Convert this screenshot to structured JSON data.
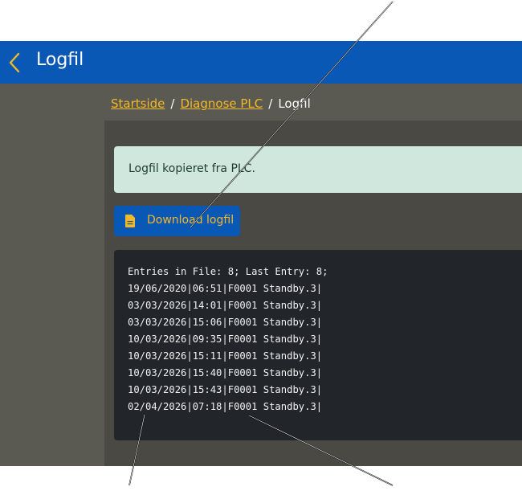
{
  "header": {
    "title": "Logfil",
    "back_icon": "chevron-left-icon",
    "accent": "#f2b826",
    "bar_color": "#0a58b5"
  },
  "breadcrumb": {
    "items": [
      "Startside",
      "Diagnose PLC"
    ],
    "separator": "/",
    "current": "Logfil"
  },
  "alert": {
    "message": "Logfil kopieret fra PLC."
  },
  "download": {
    "label": "Download logfil",
    "icon": "document-icon"
  },
  "log": {
    "lines": [
      "Entries in File: 8; Last Entry: 8;",
      "19/06/2020|06:51|F0001 Standby.3|",
      "03/03/2026|14:01|F0001 Standby.3|",
      "03/03/2026|15:06|F0001 Standby.3|",
      "10/03/2026|09:35|F0001 Standby.3|",
      "10/03/2026|15:11|F0001 Standby.3|",
      "10/03/2026|15:40|F0001 Standby.3|",
      "10/03/2026|15:43|F0001 Standby.3|",
      "02/04/2026|07:18|F0001 Standby.3|"
    ]
  }
}
